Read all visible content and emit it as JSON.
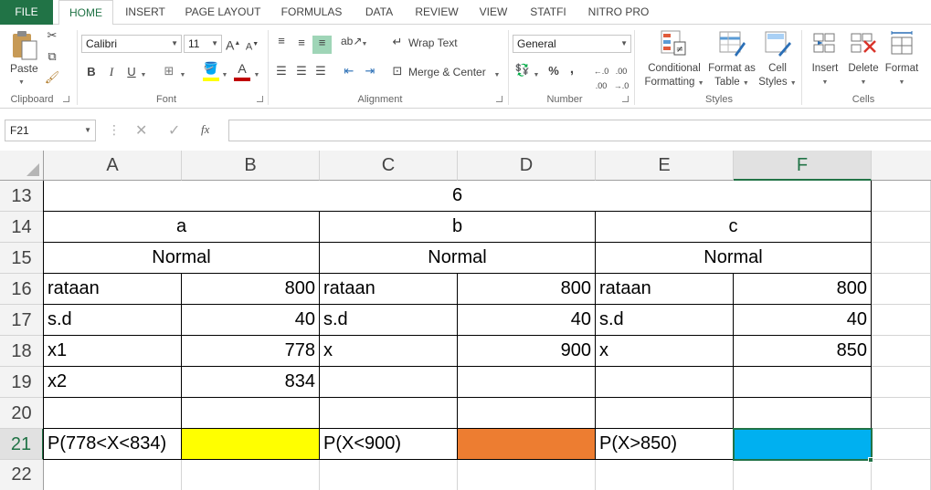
{
  "menu": {
    "tabs": [
      "FILE",
      "HOME",
      "INSERT",
      "PAGE LAYOUT",
      "FORMULAS",
      "DATA",
      "REVIEW",
      "VIEW",
      "STATFI",
      "NITRO PRO"
    ],
    "active": "HOME"
  },
  "ribbon": {
    "clipboard": {
      "paste": "Paste",
      "label": "Clipboard"
    },
    "font": {
      "name": "Calibri",
      "size": "11",
      "label": "Font",
      "bold": "B",
      "italic": "I",
      "underline": "U",
      "grow": "A",
      "shrink": "A"
    },
    "alignment": {
      "wrap": "Wrap Text",
      "merge": "Merge & Center",
      "label": "Alignment"
    },
    "number": {
      "format": "General",
      "percent": "%",
      "comma": ",",
      "label": "Number"
    },
    "styles": {
      "conditional_1": "Conditional",
      "conditional_2": "Formatting",
      "format_table_1": "Format as",
      "format_table_2": "Table",
      "cell_styles_1": "Cell",
      "cell_styles_2": "Styles",
      "label": "Styles"
    },
    "cells": {
      "insert": "Insert",
      "delete": "Delete",
      "format": "Format",
      "label": "Cells"
    }
  },
  "formula_bar": {
    "name_box": "F21",
    "fx": "fx",
    "value": ""
  },
  "columns": [
    "A",
    "B",
    "C",
    "D",
    "E",
    "F"
  ],
  "selected_column": "F",
  "rows": [
    "13",
    "14",
    "15",
    "16",
    "17",
    "18",
    "19",
    "20",
    "21",
    "22"
  ],
  "selected_row": "21",
  "cells": {
    "r13": "6",
    "r14_a": "a",
    "r14_b": "b",
    "r14_c": "c",
    "r15_a": "Normal",
    "r15_b": "Normal",
    "r15_c": "Normal",
    "A16": "rataan",
    "B16": "800",
    "C16": "rataan",
    "D16": "800",
    "E16": "rataan",
    "F16": "800",
    "A17": "s.d",
    "B17": "40",
    "C17": "s.d",
    "D17": "40",
    "E17": "s.d",
    "F17": "40",
    "A18": "x1",
    "B18": "778",
    "C18": "x",
    "D18": "900",
    "E18": "x",
    "F18": "850",
    "A19": "x2",
    "B19": "834",
    "A21": "P(778<X<834)",
    "C21": "P(X<900)",
    "E21": "P(X>850)"
  },
  "colors": {
    "excel_green": "#217346",
    "yellow_fill": "#ffff00",
    "orange_fill": "#ed7d31",
    "blue_fill": "#00b0f0"
  }
}
